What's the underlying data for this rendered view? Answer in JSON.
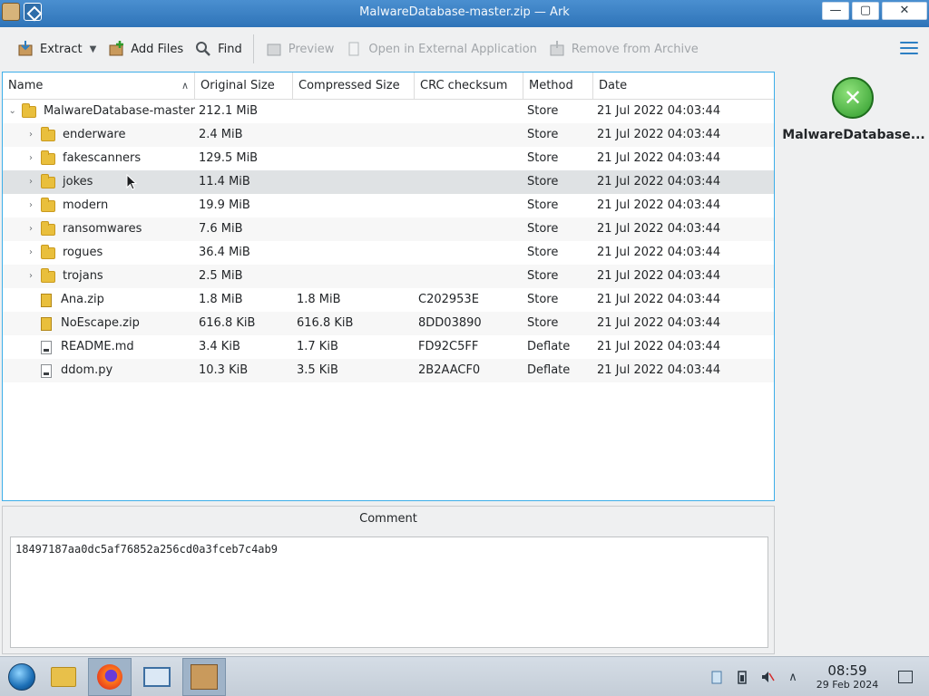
{
  "window": {
    "title": "MalwareDatabase-master.zip — Ark",
    "minimize": "—",
    "maximize": "▢",
    "close": "✕"
  },
  "toolbar": {
    "extract": "Extract",
    "add_files": "Add Files",
    "find": "Find",
    "preview": "Preview",
    "open_external": "Open in External Application",
    "remove": "Remove from Archive"
  },
  "table": {
    "columns": [
      "Name",
      "Original Size",
      "Compressed Size",
      "CRC checksum",
      "Method",
      "Date"
    ],
    "rows": [
      {
        "name": "MalwareDatabase-master",
        "type": "folder",
        "expander": "⌄",
        "level": 0,
        "orig": "212.1 MiB",
        "comp": "",
        "crc": "",
        "method": "Store",
        "date": "21 Jul 2022 04:03:44"
      },
      {
        "name": "enderware",
        "type": "folder",
        "expander": "›",
        "level": 1,
        "orig": "2.4 MiB",
        "comp": "",
        "crc": "",
        "method": "Store",
        "date": "21 Jul 2022 04:03:44"
      },
      {
        "name": "fakescanners",
        "type": "folder",
        "expander": "›",
        "level": 1,
        "orig": "129.5 MiB",
        "comp": "",
        "crc": "",
        "method": "Store",
        "date": "21 Jul 2022 04:03:44"
      },
      {
        "name": "jokes",
        "type": "folder",
        "expander": "›",
        "level": 1,
        "orig": "11.4 MiB",
        "comp": "",
        "crc": "",
        "method": "Store",
        "date": "21 Jul 2022 04:03:44"
      },
      {
        "name": "modern",
        "type": "folder",
        "expander": "›",
        "level": 1,
        "orig": "19.9 MiB",
        "comp": "",
        "crc": "",
        "method": "Store",
        "date": "21 Jul 2022 04:03:44"
      },
      {
        "name": "ransomwares",
        "type": "folder",
        "expander": "›",
        "level": 1,
        "orig": "7.6 MiB",
        "comp": "",
        "crc": "",
        "method": "Store",
        "date": "21 Jul 2022 04:03:44"
      },
      {
        "name": "rogues",
        "type": "folder",
        "expander": "›",
        "level": 1,
        "orig": "36.4 MiB",
        "comp": "",
        "crc": "",
        "method": "Store",
        "date": "21 Jul 2022 04:03:44"
      },
      {
        "name": "trojans",
        "type": "folder",
        "expander": "›",
        "level": 1,
        "orig": "2.5 MiB",
        "comp": "",
        "crc": "",
        "method": "Store",
        "date": "21 Jul 2022 04:03:44"
      },
      {
        "name": "Ana.zip",
        "type": "zip",
        "expander": "",
        "level": 1,
        "orig": "1.8 MiB",
        "comp": "1.8 MiB",
        "crc": "C202953E",
        "method": "Store",
        "date": "21 Jul 2022 04:03:44"
      },
      {
        "name": "NoEscape.zip",
        "type": "zip",
        "expander": "",
        "level": 1,
        "orig": "616.8 KiB",
        "comp": "616.8 KiB",
        "crc": "8DD03890",
        "method": "Store",
        "date": "21 Jul 2022 04:03:44"
      },
      {
        "name": "README.md",
        "type": "file",
        "expander": "",
        "level": 1,
        "orig": "3.4 KiB",
        "comp": "1.7 KiB",
        "crc": "FD92C5FF",
        "method": "Deflate",
        "date": "21 Jul 2022 04:03:44"
      },
      {
        "name": "ddom.py",
        "type": "file",
        "expander": "",
        "level": 1,
        "orig": "10.3 KiB",
        "comp": "3.5 KiB",
        "crc": "2B2AACF0",
        "method": "Deflate",
        "date": "21 Jul 2022 04:03:44"
      }
    ]
  },
  "side_panel": {
    "archive_name": "MalwareDatabase..."
  },
  "comment": {
    "label": "Comment",
    "text": "18497187aa0dc5af76852a256cd0a3fceb7c4ab9"
  },
  "taskbar": {
    "time": "08:59",
    "date": "29 Feb 2024"
  },
  "colors": {
    "titlebar": "#2f74b8",
    "selection_border": "#3daee9",
    "hover_row": "#dfe2e4"
  }
}
